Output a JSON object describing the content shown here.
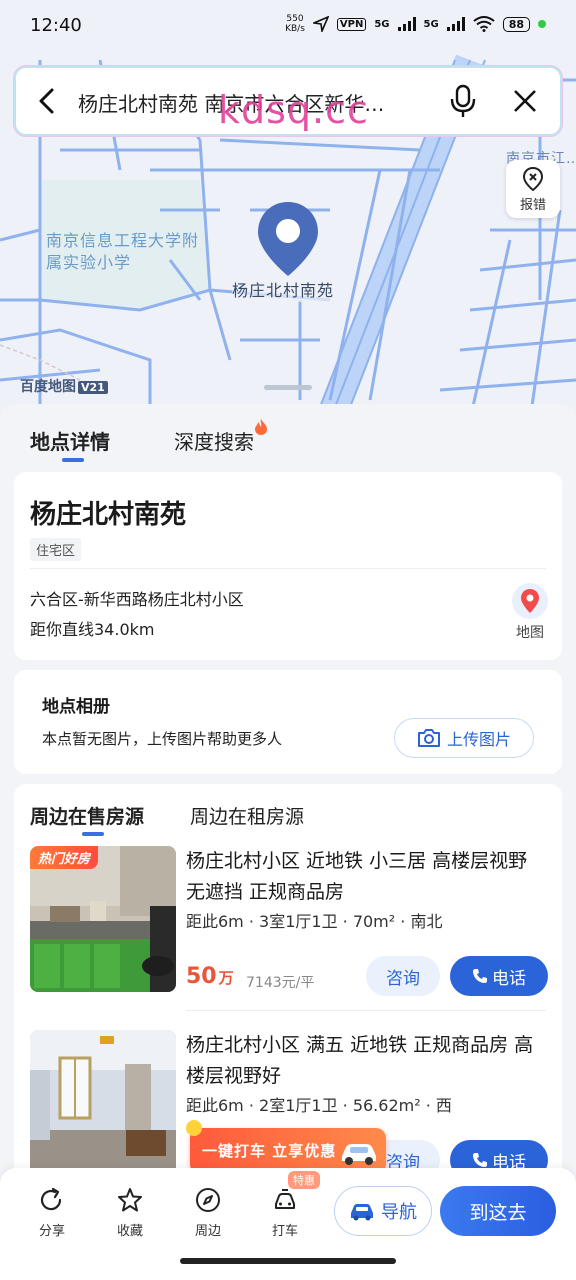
{
  "status_bar": {
    "time": "12:40",
    "speed_value": "550",
    "speed_unit": "KB/s",
    "vpn": "VPN",
    "sig1": "5G",
    "sig2": "5G",
    "battery": "88"
  },
  "search": {
    "query": "杨庄北村南苑 南京市六合区新华…",
    "watermark": "kdsq.cc"
  },
  "map": {
    "school_label": "南京信息工程大学附属实验小学",
    "poi_label": "杨庄北村南苑",
    "corner_label": "南京市江…年",
    "logo_text": "百度地图",
    "logo_badge": "V21",
    "report_label": "报错"
  },
  "tabs": {
    "details": "地点详情",
    "deep_search": "深度搜索"
  },
  "place": {
    "name": "杨庄北村南苑",
    "tag": "住宅区",
    "address": "六合区-新华西路杨庄北村小区",
    "distance": "距你直线34.0km",
    "map_label": "地图"
  },
  "album": {
    "title": "地点相册",
    "desc": "本点暂无图片，上传图片帮助更多人",
    "upload_label": "上传图片"
  },
  "houses": {
    "tab_sale": "周边在售房源",
    "tab_rent": "周边在租房源",
    "listings": [
      {
        "badge": "热门好房",
        "title": "杨庄北村小区 近地铁 小三居 高楼层视野无遮挡 正规商品房",
        "meta": "距此6m · 3室1厅1卫 · 70m² · 南北",
        "price": "50",
        "price_unit": "万",
        "unit_price": "7143元/平",
        "consult": "咨询",
        "call": "电话"
      },
      {
        "title": "杨庄北村小区 满五 近地铁 正规商品房 高楼层视野好",
        "meta": "距此6m · 2室1厅1卫 · 56.62m² · 西",
        "consult": "咨询",
        "call": "电话"
      }
    ]
  },
  "promo": {
    "text": "一键打车 立享优惠"
  },
  "bottom_bar": {
    "share": "分享",
    "favorite": "收藏",
    "nearby": "周边",
    "taxi": "打车",
    "taxi_badge": "特惠",
    "navigate": "导航",
    "go": "到这去"
  },
  "colors": {
    "accent": "#2b64d8",
    "price": "#e8563a",
    "promo": "#ff5a3c"
  }
}
